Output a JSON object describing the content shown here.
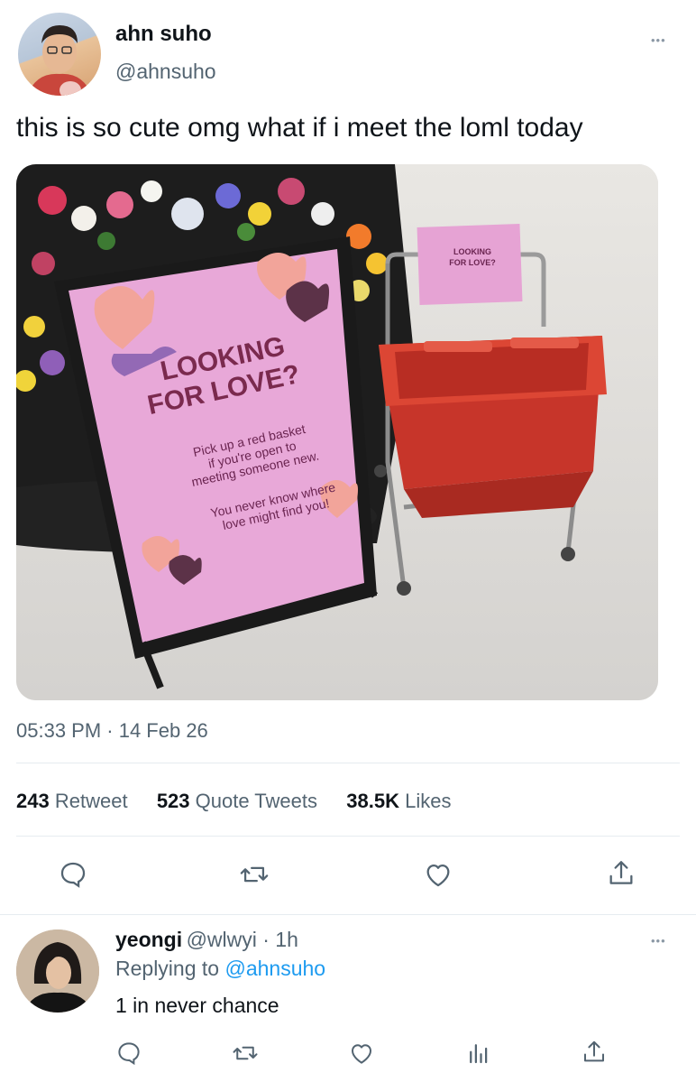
{
  "tweet": {
    "author_name": "ahn suho",
    "author_handle": "@ahnsuho",
    "text": "this is so cute omg what if i meet the loml today",
    "timestamp": "05:33 PM · 14 Feb 26",
    "stats": {
      "retweets_count": "243",
      "retweets_label": "Retweet",
      "quotes_count": "523",
      "quotes_label": "Quote Tweets",
      "likes_count": "38.5K",
      "likes_label": "Likes"
    },
    "more_glyph": "•••",
    "image": {
      "sign_title_1": "LOOKING",
      "sign_title_2": "FOR LOVE?",
      "sign_line_1": "Pick up a red basket",
      "sign_line_2": "if you're open to",
      "sign_line_3": "meeting someone new.",
      "sign_line_4": "You never know where",
      "sign_line_5": "love might find you!",
      "small_sign_1": "LOOKING",
      "small_sign_2": "FOR LOVE?"
    }
  },
  "reply": {
    "author_name": "yeongi",
    "meta": "@wlwyi · 1h",
    "replying_prefix": "Replying to ",
    "replying_handle": "@ahnsuho",
    "text": "1 in never chance",
    "more_glyph": "•••"
  },
  "icons": {
    "reply": "comment-icon",
    "retweet": "retweet-icon",
    "like": "heart-icon",
    "share": "share-icon",
    "analytics": "analytics-icon"
  },
  "colors": {
    "accent": "#1d9bf0",
    "text": "#0f1419",
    "secondary": "#536471",
    "divider": "#e6ecf0",
    "sign_pink": "#e8a8d8",
    "basket_red": "#d83a2c"
  }
}
